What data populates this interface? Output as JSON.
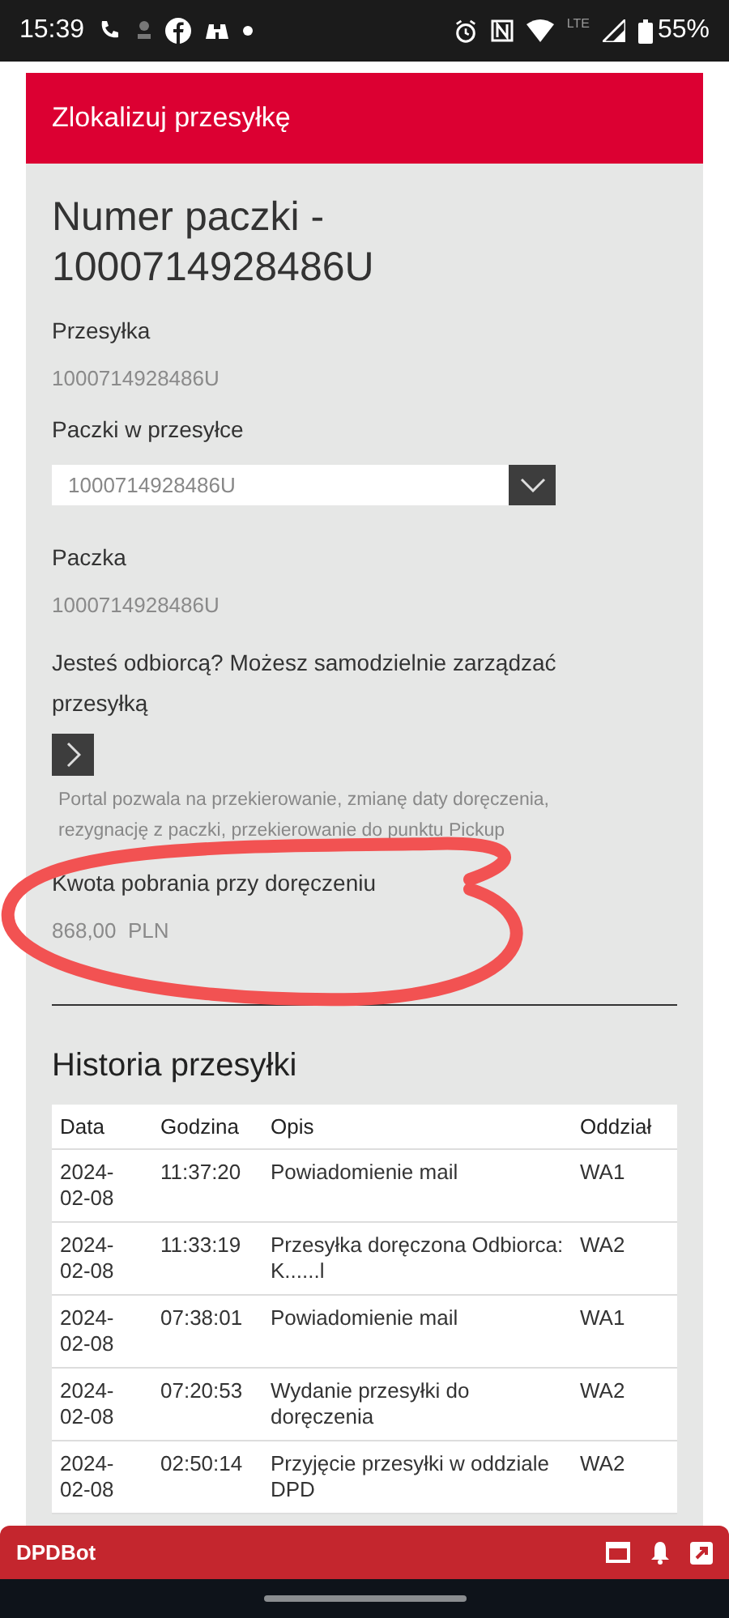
{
  "status_bar": {
    "time": "15:39",
    "network": "LTE",
    "battery": "55%"
  },
  "header": {
    "title": "Zlokalizuj przesyłkę"
  },
  "parcel_title": "Numer paczki - 1000714928486U",
  "shipment": {
    "label": "Przesyłka",
    "value": "1000714928486U"
  },
  "parcels_select": {
    "label": "Paczki w przesyłce",
    "value": "1000714928486U"
  },
  "parcel": {
    "label": "Paczka",
    "value": "1000714928486U"
  },
  "manage": {
    "question": "Jesteś odbiorcą? Możesz samodzielnie zarządzać przesyłką",
    "note": "Portal pozwala na przekierowanie, zmianę daty doręczenia, rezygnację z paczki, przekierowanie do punktu Pickup"
  },
  "cod": {
    "label": "Kwota pobrania przy doręczeniu",
    "value": "868,00  PLN"
  },
  "history": {
    "title": "Historia przesyłki",
    "columns": [
      "Data",
      "Godzina",
      "Opis",
      "Oddział"
    ],
    "rows": [
      {
        "date": "2024-02-08",
        "time": "11:37:20",
        "desc": "Powiadomienie mail",
        "branch": "WA1"
      },
      {
        "date": "2024-02-08",
        "time": "11:33:19",
        "desc": "Przesyłka doręczona Odbiorca: K......l",
        "branch": "WA2"
      },
      {
        "date": "2024-02-08",
        "time": "07:38:01",
        "desc": "Powiadomienie mail",
        "branch": "WA1"
      },
      {
        "date": "2024-02-08",
        "time": "07:20:53",
        "desc": "Wydanie przesyłki do doręczenia",
        "branch": "WA2"
      },
      {
        "date": "2024-02-08",
        "time": "02:50:14",
        "desc": "Przyjęcie przesyłki w oddziale DPD",
        "branch": "WA2"
      }
    ]
  },
  "chat_bar": {
    "title": "DPDBot"
  }
}
